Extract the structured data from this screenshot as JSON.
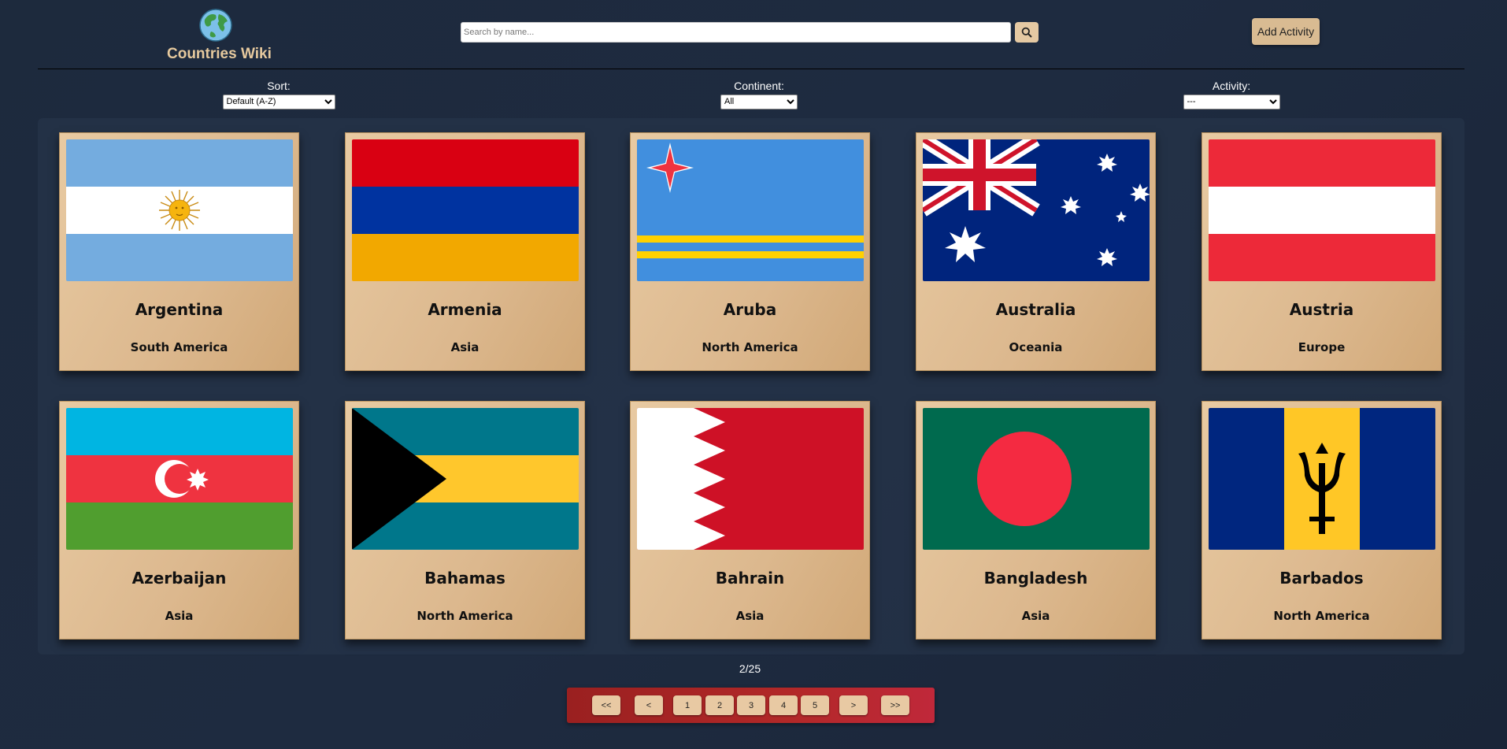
{
  "header": {
    "logo_text": "Countries Wiki",
    "search": {
      "placeholder": "Search by name...",
      "value": ""
    },
    "add_activity_label": "Add Activity"
  },
  "filters": {
    "sort": {
      "label": "Sort:",
      "selected": "Default (A-Z)"
    },
    "continent": {
      "label": "Continent:",
      "selected": "All"
    },
    "activity": {
      "label": "Activity:",
      "selected": "---"
    }
  },
  "countries": [
    {
      "name": "Argentina",
      "continent": "South America"
    },
    {
      "name": "Armenia",
      "continent": "Asia"
    },
    {
      "name": "Aruba",
      "continent": "North America"
    },
    {
      "name": "Australia",
      "continent": "Oceania"
    },
    {
      "name": "Austria",
      "continent": "Europe"
    },
    {
      "name": "Azerbaijan",
      "continent": "Asia"
    },
    {
      "name": "Bahamas",
      "continent": "North America"
    },
    {
      "name": "Bahrain",
      "continent": "Asia"
    },
    {
      "name": "Bangladesh",
      "continent": "Asia"
    },
    {
      "name": "Barbados",
      "continent": "North America"
    }
  ],
  "pagination": {
    "indicator": "2/25",
    "first": "<<",
    "prev": "<",
    "pages": [
      "1",
      "2",
      "3",
      "4",
      "5"
    ],
    "next": ">",
    "last": ">>"
  },
  "colors": {
    "accent": "#e6c99e",
    "card": "#dcb88e",
    "pagination_bg": "#b22828"
  }
}
